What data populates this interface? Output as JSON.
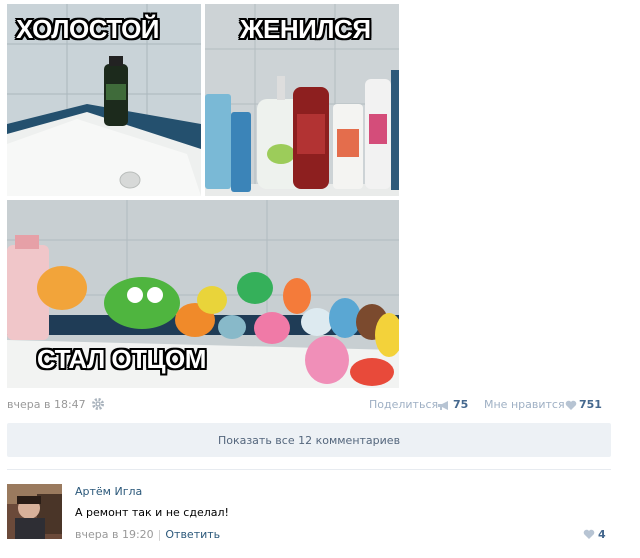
{
  "photos": {
    "bachelor_caption": "ХОЛОСТОЙ",
    "married_caption": "ЖЕНИЛСЯ",
    "father_caption": "СТАЛ ОТЦОМ"
  },
  "post_meta": {
    "time": "вчера в 18:47",
    "share_label": "Поделиться",
    "share_count": "75",
    "like_label": "Мне нравится",
    "like_count": "751"
  },
  "show_all_comments": "Показать все 12 комментариев",
  "comment": {
    "author": "Артём Игла",
    "text": "А ремонт так и не сделал!",
    "time": "вчера в 19:20",
    "reply_label": "Ответить",
    "like_count": "4"
  },
  "colors": {
    "link": "#2b587a",
    "muted": "#999999",
    "panel": "#edf1f5"
  },
  "icons": {
    "gear": "gear-icon",
    "share": "megaphone-icon",
    "like": "heart-icon"
  }
}
